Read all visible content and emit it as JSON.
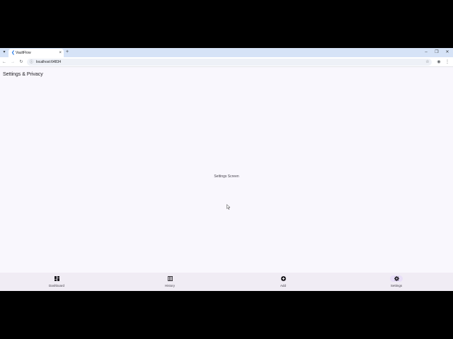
{
  "browser": {
    "tab_title": "VaultFlow",
    "new_tab_symbol": "+",
    "tab_close_symbol": "×",
    "url": "localhost:64834"
  },
  "app": {
    "page_title": "Settings & Privacy",
    "center_text": "Settings Screen"
  },
  "bottom_nav": {
    "items": [
      {
        "label": "Dashboard",
        "icon": "dashboard-icon",
        "active": false
      },
      {
        "label": "History",
        "icon": "history-icon",
        "active": false
      },
      {
        "label": "Add",
        "icon": "add-circle-icon",
        "active": false
      },
      {
        "label": "Settings",
        "icon": "gear-icon",
        "active": true
      }
    ]
  },
  "colors": {
    "background": "#f9f7fd",
    "nav_bar": "#f0ecf4",
    "active_indicator": "#e8def8",
    "tab_strip": "#d6e3f7"
  }
}
